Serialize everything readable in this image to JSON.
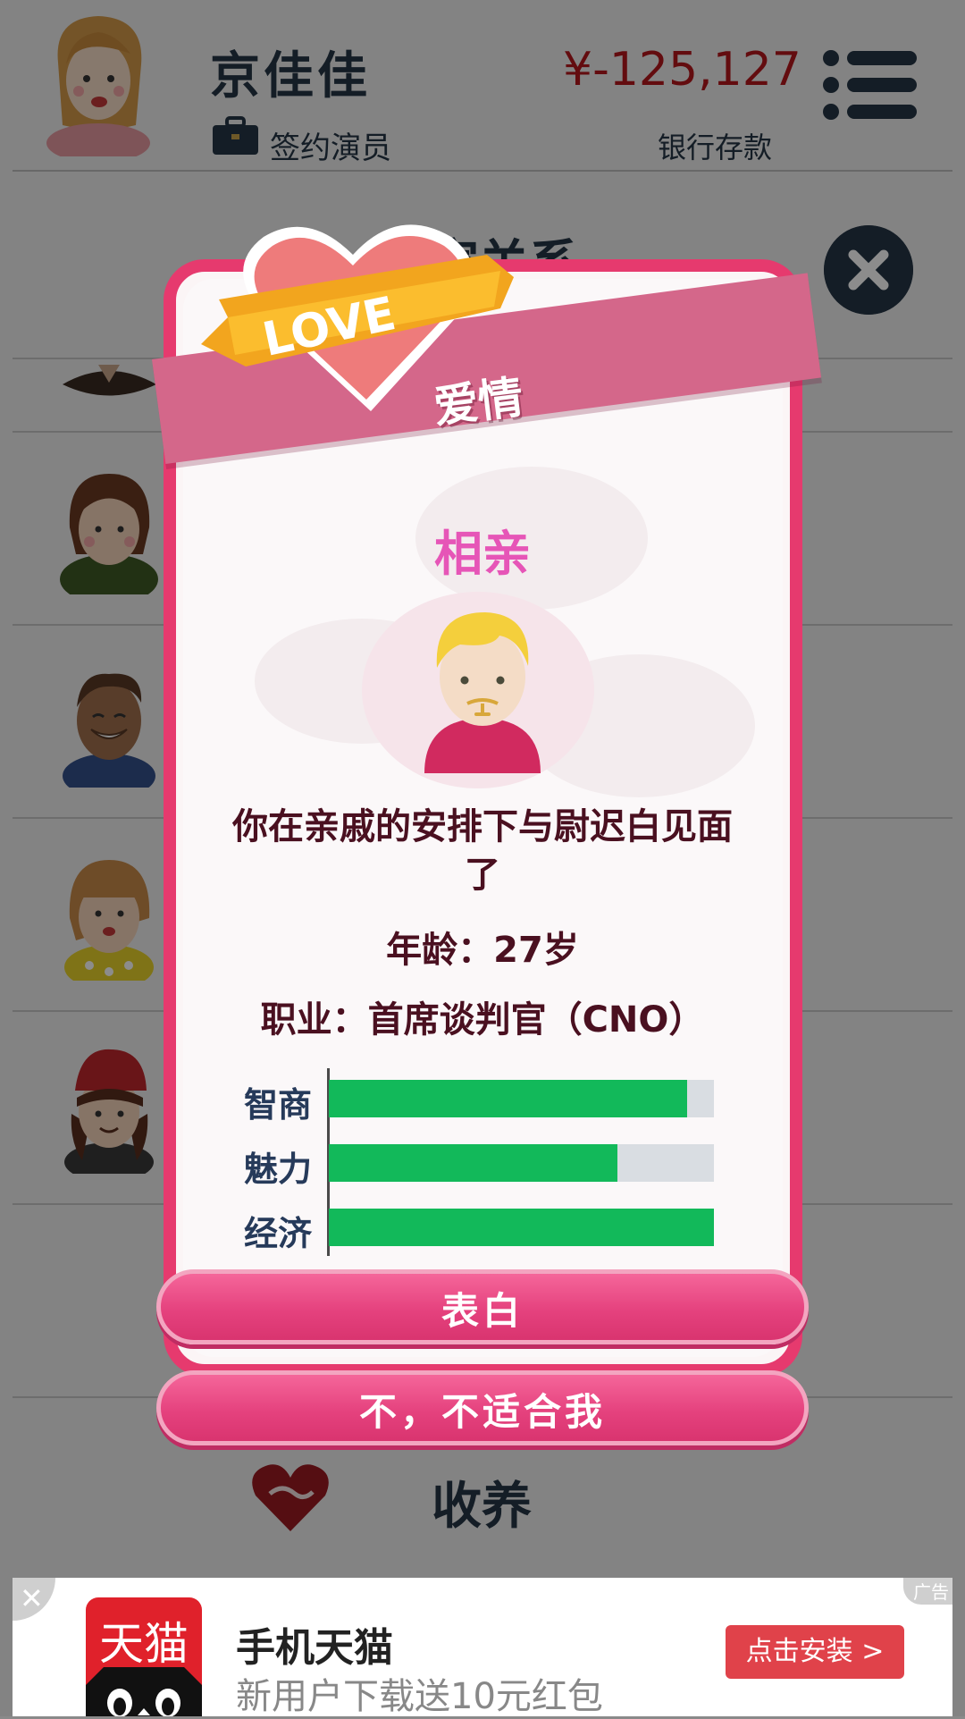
{
  "header": {
    "player_name": "京佳佳",
    "job_label": "签约演员",
    "money": "¥-125,127",
    "money_label": "银行存款"
  },
  "background": {
    "section_title": "家关系",
    "adopt_label": "收养"
  },
  "modal": {
    "banner_title": "爱情",
    "love_text": "LOVE",
    "date_title": "相亲",
    "story": "你在亲戚的安排下与尉迟白见面了",
    "age": "年龄：27岁",
    "job": "职业：首席谈判官（CNO）",
    "stats": [
      {
        "label": "智商",
        "value": 0.93
      },
      {
        "label": "魅力",
        "value": 0.75
      },
      {
        "label": "经济",
        "value": 1.0
      }
    ],
    "confess_button": "表白",
    "decline_button": "不，不适合我"
  },
  "ad": {
    "close": "✕",
    "tag": "广告",
    "logo_text": "天猫",
    "title": "手机天猫",
    "subtitle": "新用户下载送10元红包",
    "install_button": "点击安装 >"
  },
  "colors": {
    "accent_pink": "#e63a6e",
    "bar_green": "#12b95a",
    "money_red": "#b4171c",
    "navy": "#263645"
  }
}
